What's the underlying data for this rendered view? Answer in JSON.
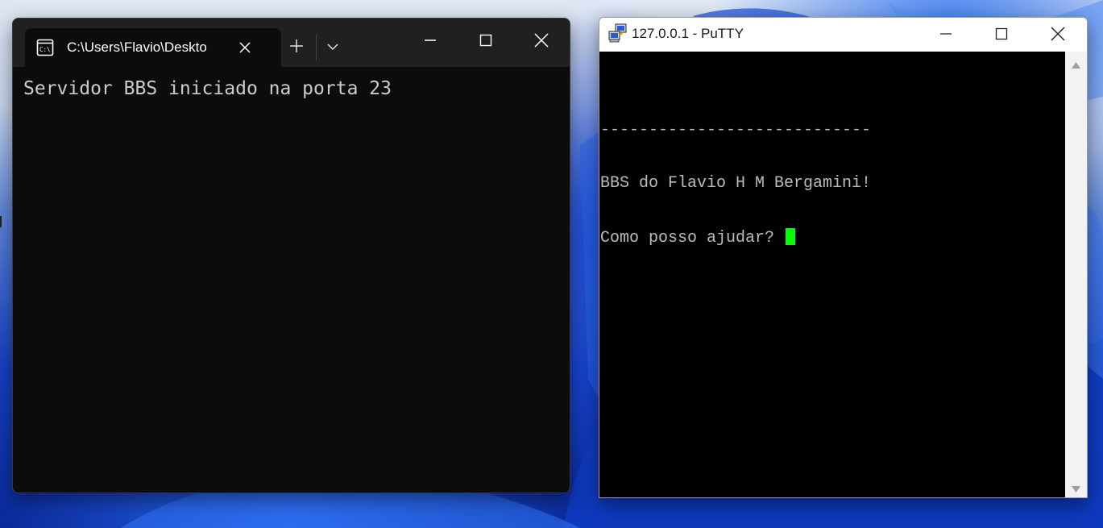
{
  "terminal": {
    "tab_title": "C:\\Users\\Flavio\\Deskto",
    "output_line": "Servidor BBS iniciado na porta 23"
  },
  "putty": {
    "title": "127.0.0.1 - PuTTY",
    "lines": [
      "----------------------------",
      "BBS do Flavio H M Bergamini!",
      "Como posso ajudar? "
    ],
    "cursor_color": "#00ff00"
  },
  "colors": {
    "terminal_bg": "#0c0c0c",
    "terminal_titlebar": "#202020",
    "putty_bg": "#000000",
    "putty_text": "#bbbbbb",
    "wallpaper_accent": "#1440c4"
  },
  "icons": {
    "terminal_tab": "cmd-prompt-icon",
    "putty": "putty-computers-icon",
    "new_tab": "plus-icon",
    "dropdown": "chevron-down-icon",
    "minimize": "minimize-icon",
    "maximize": "maximize-icon",
    "close": "close-icon"
  }
}
